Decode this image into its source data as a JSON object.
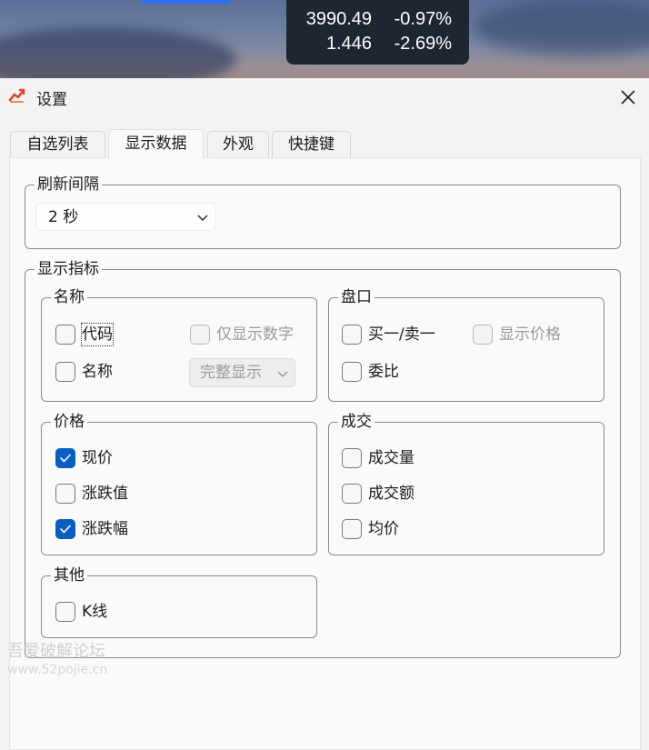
{
  "ticker": {
    "rows": [
      {
        "value": "3990.49",
        "change": "-0.97%"
      },
      {
        "value": "1.446",
        "change": "-2.69%"
      }
    ]
  },
  "dialog": {
    "title": "设置",
    "icon": "stock-chart-icon",
    "close_icon": "close-icon",
    "tabs": [
      {
        "label": "自选列表",
        "active": false
      },
      {
        "label": "显示数据",
        "active": true
      },
      {
        "label": "外观",
        "active": false
      },
      {
        "label": "快捷键",
        "active": false
      }
    ]
  },
  "refresh": {
    "label": "刷新间隔",
    "selected": "2 秒"
  },
  "display": {
    "label": "显示指标",
    "name_group": {
      "label": "名称",
      "code": {
        "label": "代码",
        "checked": false
      },
      "numbers_only": {
        "label": "仅显示数字",
        "checked": false,
        "disabled": true
      },
      "name": {
        "label": "名称",
        "checked": false
      },
      "name_mode": {
        "selected": "完整显示",
        "disabled": true
      }
    },
    "order_book": {
      "label": "盘口",
      "bid_ask": {
        "label": "买一/卖一",
        "checked": false
      },
      "show_price": {
        "label": "显示价格",
        "checked": false,
        "disabled": true
      },
      "ratio": {
        "label": "委比",
        "checked": false
      }
    },
    "price": {
      "label": "价格",
      "current": {
        "label": "现价",
        "checked": true
      },
      "change_value": {
        "label": "涨跌值",
        "checked": false
      },
      "change_pct": {
        "label": "涨跌幅",
        "checked": true
      }
    },
    "volume": {
      "label": "成交",
      "volume": {
        "label": "成交量",
        "checked": false
      },
      "amount": {
        "label": "成交额",
        "checked": false
      },
      "avg_price": {
        "label": "均价",
        "checked": false
      }
    },
    "other": {
      "label": "其他",
      "kline": {
        "label": "K线",
        "checked": false
      }
    }
  },
  "watermark": {
    "text": "吾爱破解论坛",
    "url": "www.52pojie.cn"
  },
  "colors": {
    "accent": "#0a5dc2",
    "ticker_bg": "#1e2633"
  }
}
